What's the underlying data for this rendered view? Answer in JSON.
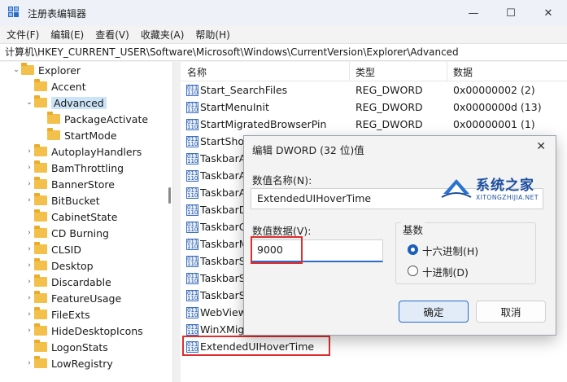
{
  "window": {
    "title": "注册表编辑器",
    "controls": {
      "minimize": "—",
      "maximize": "☐",
      "close": "✕"
    }
  },
  "menu": [
    "文件(F)",
    "编辑(E)",
    "查看(V)",
    "收藏夹(A)",
    "帮助(H)"
  ],
  "address": "计算机\\HKEY_CURRENT_USER\\Software\\Microsoft\\Windows\\CurrentVersion\\Explorer\\Advanced",
  "tree": [
    {
      "label": "Explorer",
      "expanded": true
    },
    {
      "label": "Accent"
    },
    {
      "label": "Advanced",
      "expanded": true,
      "selected": true
    },
    {
      "label": "PackageActivate"
    },
    {
      "label": "StartMode"
    },
    {
      "label": "AutoplayHandlers"
    },
    {
      "label": "BamThrottling"
    },
    {
      "label": "BannerStore"
    },
    {
      "label": "BitBucket"
    },
    {
      "label": "CabinetState"
    },
    {
      "label": "CD Burning"
    },
    {
      "label": "CLSID"
    },
    {
      "label": "Desktop"
    },
    {
      "label": "Discardable"
    },
    {
      "label": "FeatureUsage"
    },
    {
      "label": "FileExts"
    },
    {
      "label": "HideDesktopIcons"
    },
    {
      "label": "LogonStats"
    },
    {
      "label": "LowRegistry"
    }
  ],
  "list": {
    "headers": {
      "name": "名称",
      "type": "类型",
      "data": "数据"
    },
    "rows": [
      {
        "name": "Start_SearchFiles",
        "type": "REG_DWORD",
        "data": "0x00000002 (2)"
      },
      {
        "name": "StartMenuInit",
        "type": "REG_DWORD",
        "data": "0x0000000d (13)"
      },
      {
        "name": "StartMigratedBrowserPin",
        "type": "REG_DWORD",
        "data": "0x00000001 (1)"
      },
      {
        "name": "StartShow",
        "type": "",
        "data": ""
      },
      {
        "name": "TaskbarA",
        "type": "",
        "data": ""
      },
      {
        "name": "TaskbarA",
        "type": "",
        "data": ""
      },
      {
        "name": "TaskbarA",
        "type": "",
        "data": ""
      },
      {
        "name": "TaskbarD",
        "type": "",
        "data": ""
      },
      {
        "name": "TaskbarG",
        "type": "",
        "data": ""
      },
      {
        "name": "TaskbarM",
        "type": "",
        "data": ""
      },
      {
        "name": "TaskbarS",
        "type": "",
        "data": ""
      },
      {
        "name": "TaskbarS",
        "type": "",
        "data": ""
      },
      {
        "name": "TaskbarS",
        "type": "",
        "data": ""
      },
      {
        "name": "WebView",
        "type": "",
        "data": ""
      },
      {
        "name": "WinXMig",
        "type": "",
        "data": ""
      },
      {
        "name": "ExtendedUIHoverTime",
        "type": "",
        "data": ""
      }
    ]
  },
  "dialog": {
    "title": "编辑 DWORD (32 位)值",
    "close": "✕",
    "name_label": "数值名称(N):",
    "name_value": "ExtendedUIHoverTime",
    "data_label": "数值数据(V):",
    "data_value": "9000",
    "base_label": "基数",
    "hex_label": "十六进制(H)",
    "dec_label": "十进制(D)",
    "selected_base": "hex",
    "ok": "确定",
    "cancel": "取消"
  },
  "watermark": {
    "title": "系统之家",
    "subtitle": "XITONGZHIJIA.NET"
  },
  "colors": {
    "accent": "#2a6bc6",
    "highlight_box": "#e02d2d",
    "folder": "#f3c14b"
  }
}
